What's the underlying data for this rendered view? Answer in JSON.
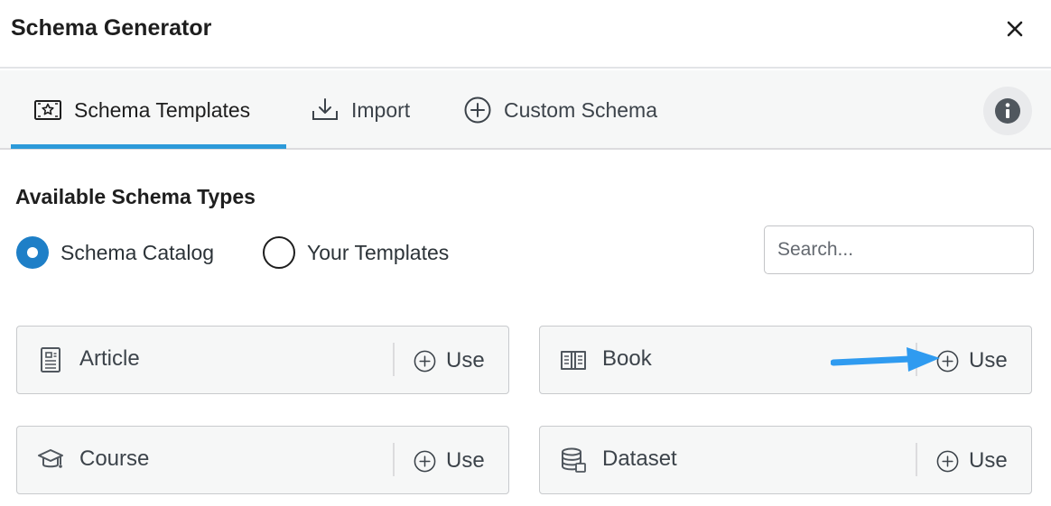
{
  "dialog": {
    "title": "Schema Generator"
  },
  "tabs": [
    {
      "label": "Schema Templates",
      "icon": "template-icon",
      "active": true
    },
    {
      "label": "Import",
      "icon": "import-icon",
      "active": false
    },
    {
      "label": "Custom Schema",
      "icon": "plus-circle-icon",
      "active": false
    }
  ],
  "section": {
    "title": "Available Schema Types",
    "radios": [
      {
        "label": "Schema Catalog",
        "checked": true
      },
      {
        "label": "Your Templates",
        "checked": false
      }
    ],
    "search_placeholder": "Search..."
  },
  "schema_types": [
    {
      "name": "Article",
      "icon": "article-icon",
      "action": "Use"
    },
    {
      "name": "Book",
      "icon": "book-icon",
      "action": "Use"
    },
    {
      "name": "Course",
      "icon": "graduation-cap-icon",
      "action": "Use"
    },
    {
      "name": "Dataset",
      "icon": "database-icon",
      "action": "Use"
    }
  ],
  "colors": {
    "accent": "#2c9ad9",
    "radio_checked": "#1e7fc7",
    "annotation_arrow": "#2f9bf0"
  }
}
